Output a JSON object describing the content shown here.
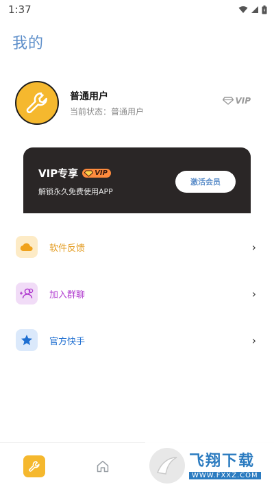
{
  "status_bar": {
    "time": "1:37"
  },
  "page": {
    "title": "我的"
  },
  "profile": {
    "username": "普通用户",
    "status_text": "当前状态：普通用户",
    "vip_badge": "VIP"
  },
  "vip_card": {
    "title": "VIP专享",
    "pill_label": "VIP",
    "description": "解锁永久免费使用APP",
    "button_label": "激活会员"
  },
  "menu": {
    "items": [
      {
        "label": "软件反馈",
        "icon": "cloud-icon",
        "color": "#e39b1f",
        "bg": "#fdebc6"
      },
      {
        "label": "加入群聊",
        "icon": "add-group-icon",
        "color": "#b03ccf",
        "bg": "#f1dcf7"
      },
      {
        "label": "官方快手",
        "icon": "star-icon",
        "color": "#1f6fd1",
        "bg": "#dbe9fb"
      }
    ]
  },
  "bottom_nav": {
    "items": [
      {
        "icon": "wrench-icon",
        "active": true
      },
      {
        "icon": "home-icon",
        "active": false
      }
    ]
  },
  "watermark": {
    "title": "飞翔下载",
    "url": "WWW.FXXZ.COM"
  },
  "colors": {
    "accent": "#5b8dc9",
    "vip_card_bg": "#2a2626",
    "avatar_bg": "#f5b82e"
  }
}
